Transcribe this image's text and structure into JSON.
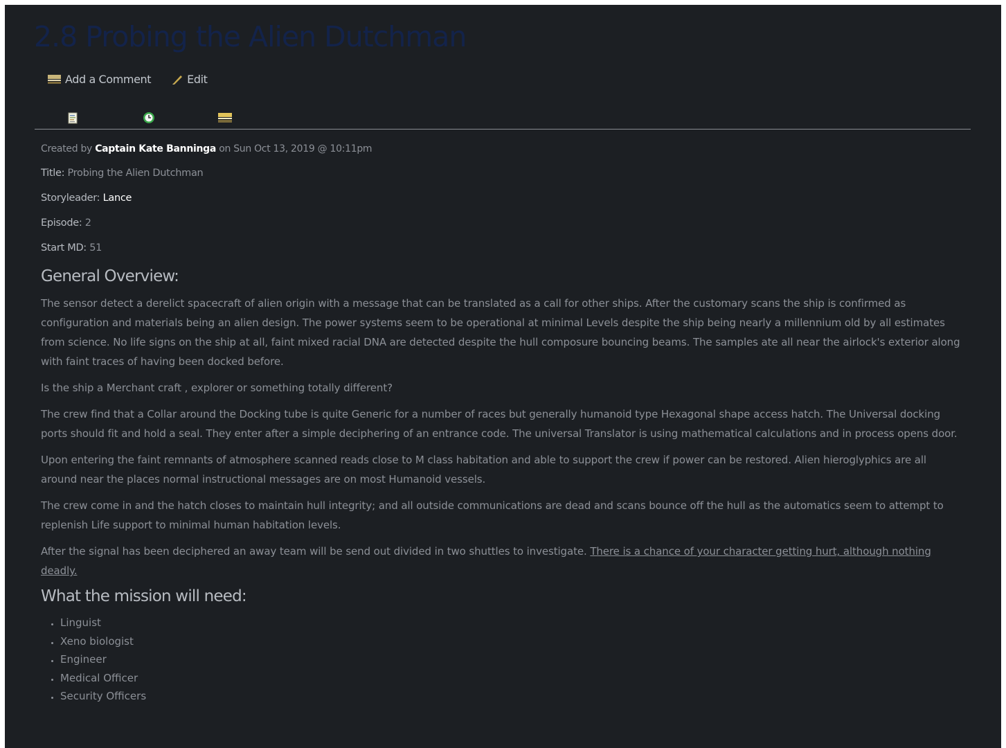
{
  "page": {
    "title": "2.8 Probing the Alien Dutchman"
  },
  "actions": {
    "comment_label": "Add a Comment",
    "edit_label": "Edit"
  },
  "tabs": [
    {
      "icon": "document-icon"
    },
    {
      "icon": "history-icon"
    },
    {
      "icon": "comments-icon"
    }
  ],
  "meta": {
    "created_prefix": "Created by",
    "author": "Captain Kate Banninga",
    "created_on": "on Sun Oct 13, 2019 @ 10:11pm",
    "title_label": "Title:",
    "title_value": "Probing the Alien Dutchman",
    "storyleader_label": "Storyleader:",
    "storyleader_value": "Lance",
    "episode_label": "Episode:",
    "episode_value": "2",
    "startmd_label": "Start MD:",
    "startmd_value": "51"
  },
  "overview": {
    "heading": "General Overview:",
    "p1": "The sensor detect a derelict spacecraft of alien origin with a message that can be translated as a call for other ships. After the customary scans the ship is confirmed as configuration and materials being an alien design. The power systems seem to be operational at minimal Levels despite the ship being nearly a millennium old by all estimates from science. No life signs on the ship at all, faint mixed racial DNA are detected despite the hull composure bouncing beams. The samples ate all near the airlock's exterior along with faint traces of having been docked before.",
    "p2": "Is the ship a Merchant craft , explorer or something totally different?",
    "p3": "The crew find that a Collar around the Docking tube is quite Generic for a number of races but generally humanoid type Hexagonal shape access hatch. The Universal docking ports should fit and hold a seal. They enter after a simple deciphering of an entrance code. The universal Translator is using mathematical calculations and in process opens door.",
    "p4": "Upon entering the faint remnants of atmosphere scanned reads close to M class habitation and able to support the crew if power can be restored. Alien hieroglyphics are all around near the places normal instructional messages are on most Humanoid vessels.",
    "p5": "The crew come in and the hatch closes to maintain hull integrity; and all outside communications are dead and scans bounce off the hull as the automatics seem to attempt to replenish Life support to minimal human habitation levels.",
    "p6_text": "After the signal has been deciphered an away team will be send out divided in two shuttles to investigate. ",
    "p6_warning": "There is a chance of your character getting hurt, although nothing deadly."
  },
  "needs": {
    "heading": "What the mission will need:",
    "items": [
      "Linguist",
      "Xeno biologist",
      "Engineer",
      "Medical Officer",
      "Security Officers"
    ]
  },
  "colors": {
    "background": "#1c1f23",
    "title": "#13234a",
    "text": "#8c9097",
    "highlight": "#ffffff",
    "icon_tan": "#c8b57a"
  }
}
